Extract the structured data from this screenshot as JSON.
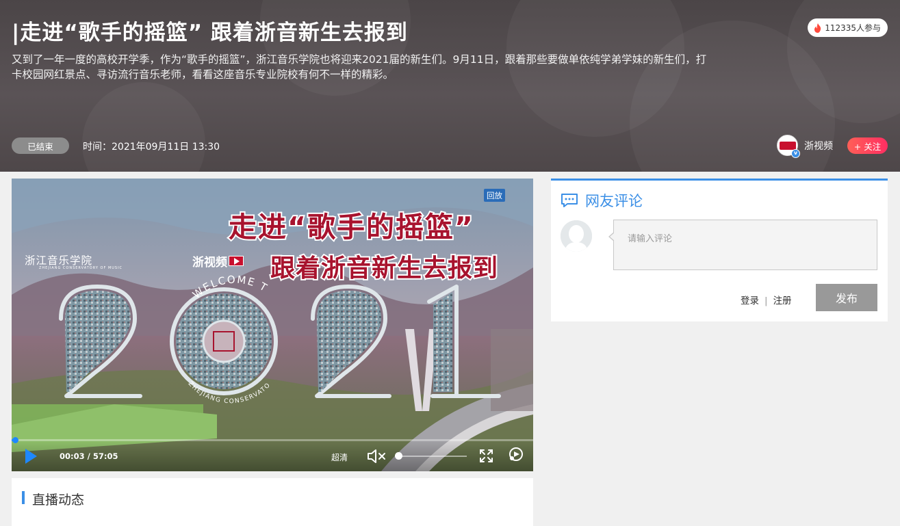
{
  "header": {
    "title": "|走进“歌手的摇篮” 跟着浙音新生去报到",
    "description": "又到了一年一度的高校开学季，作为“歌手的摇篮”，浙江音乐学院也将迎来2021届的新生们。9月11日，跟着那些要做单依纯学弟学妹的新生们，打卡校园网红景点、寻访流行音乐老师，看看这座音乐专业院校有何不一样的精彩。",
    "participants": "112335人参与",
    "status": "已结束",
    "time": "时间：2021年09月11日 13:30",
    "author_name": "浙视频",
    "follow_label": "+ 关注"
  },
  "player": {
    "replay_tag": "回放",
    "video_title_line1": "走进“歌手的摇篮”",
    "video_title_line2": "跟着浙音新生去报到",
    "school_name": "浙江音乐学院",
    "school_sub": "ZHEJIANG CONSERVATORY OF MUSIC",
    "brand_logo": "浙视频",
    "welcome_text": "WELCOME TO",
    "year_text": "2021",
    "arc_text": "ZHEJIANG CONSERVATORY OF MUSIC",
    "current_time": "00:03",
    "duration": "57:05",
    "time_separator": "/",
    "quality": "超清",
    "progress": 0.001,
    "volume": 0.0
  },
  "feed": {
    "label": "直播动态"
  },
  "comments": {
    "title": "网友评论",
    "placeholder": "请输入评论",
    "login": "登录",
    "separator": "|",
    "register": "注册",
    "publish": "发布"
  },
  "colors": {
    "accent_blue": "#3b8fe6",
    "follow_red": "#ff2e62",
    "title_red": "#a8132e"
  }
}
